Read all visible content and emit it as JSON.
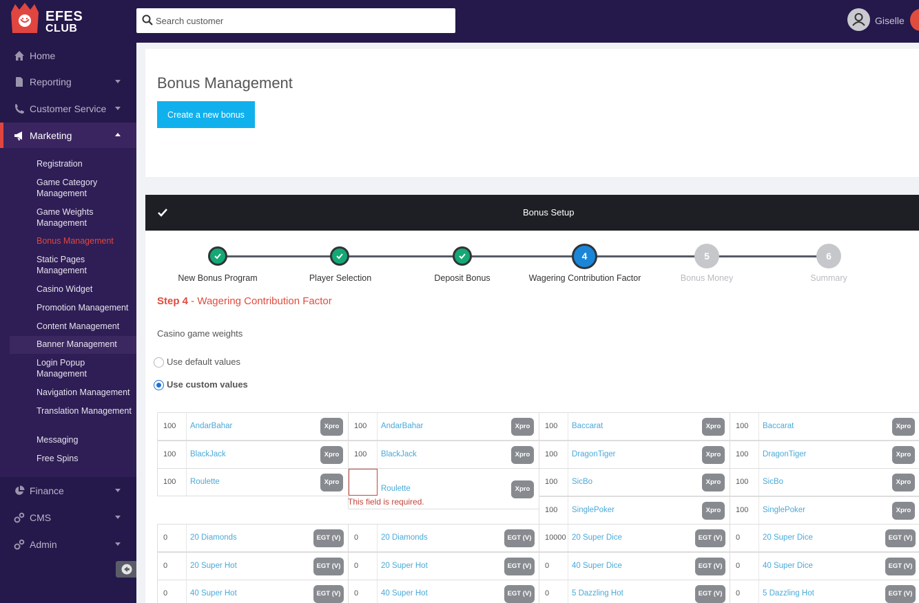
{
  "header": {
    "logo_text_1": "EFES",
    "logo_text_2": "CLUB",
    "search_placeholder": "Search customer",
    "username": "Giselle"
  },
  "sidebar": {
    "items": [
      {
        "label": "Home",
        "icon": "home-icon"
      },
      {
        "label": "Reporting",
        "icon": "file-icon"
      },
      {
        "label": "Customer Service",
        "icon": "phone-icon"
      },
      {
        "label": "Marketing",
        "icon": "megaphone-icon"
      },
      {
        "label": "Finance",
        "icon": "pie-chart-icon"
      },
      {
        "label": "CMS",
        "icon": "cogs-icon"
      },
      {
        "label": "Admin",
        "icon": "cogs-icon"
      }
    ],
    "marketing_sub": [
      "Registration",
      "Game Category Management",
      "Game Weights Management",
      "Bonus Management",
      "Static Pages Management",
      "Casino Widget",
      "Promotion Management",
      "Content Management",
      "Banner Management",
      "Login Popup Management",
      "Navigation Management",
      "Translation Management",
      "Messaging",
      "Free Spins"
    ],
    "active_sub": "Bonus Management"
  },
  "page": {
    "title": "Bonus Management",
    "create_button": "Create a new bonus"
  },
  "wizard": {
    "bar_title": "Bonus Setup",
    "steps": [
      {
        "number": "1",
        "label": "New Bonus Program",
        "state": "done"
      },
      {
        "number": "2",
        "label": "Player Selection",
        "state": "done"
      },
      {
        "number": "3",
        "label": "Deposit Bonus",
        "state": "done"
      },
      {
        "number": "4",
        "label": "Wagering Contribution Factor",
        "state": "current"
      },
      {
        "number": "5",
        "label": "Bonus Money",
        "state": "todo"
      },
      {
        "number": "6",
        "label": "Summary",
        "state": "todo"
      }
    ],
    "heading_step": "Step 4",
    "heading_sep": " - ",
    "heading_text": "Wagering Contribution Factor",
    "section_label": "Casino game weights",
    "radio_default": "Use default values",
    "radio_custom": "Use custom values",
    "error_message": "This field is required."
  },
  "columns": [
    {
      "xpro": [
        {
          "weight": "100",
          "name": "AndarBahar",
          "provider": "Xpro"
        },
        {
          "weight": "100",
          "name": "BlackJack",
          "provider": "Xpro"
        },
        {
          "weight": "100",
          "name": "Roulette",
          "provider": "Xpro"
        }
      ],
      "egt": [
        {
          "weight": "0",
          "name": "20 Diamonds",
          "provider": "EGT (V)"
        },
        {
          "weight": "0",
          "name": "20 Super Hot",
          "provider": "EGT (V)"
        },
        {
          "weight": "0",
          "name": "40 Super Hot",
          "provider": "EGT (V)"
        }
      ]
    },
    {
      "xpro": [
        {
          "weight": "100",
          "name": "AndarBahar",
          "provider": "Xpro"
        },
        {
          "weight": "100",
          "name": "BlackJack",
          "provider": "Xpro"
        },
        {
          "weight": "",
          "name": "Roulette",
          "provider": "Xpro",
          "error": true
        }
      ],
      "egt": [
        {
          "weight": "0",
          "name": "20 Diamonds",
          "provider": "EGT (V)"
        },
        {
          "weight": "0",
          "name": "20 Super Hot",
          "provider": "EGT (V)"
        },
        {
          "weight": "0",
          "name": "40 Super Hot",
          "provider": "EGT (V)"
        }
      ]
    },
    {
      "xpro": [
        {
          "weight": "100",
          "name": "Baccarat",
          "provider": "Xpro"
        },
        {
          "weight": "100",
          "name": "DragonTiger",
          "provider": "Xpro"
        },
        {
          "weight": "100",
          "name": "SicBo",
          "provider": "Xpro"
        },
        {
          "weight": "100",
          "name": "SinglePoker",
          "provider": "Xpro"
        }
      ],
      "egt": [
        {
          "weight": "10000",
          "name": "20 Super Dice",
          "provider": "EGT (V)"
        },
        {
          "weight": "0",
          "name": "40 Super Dice",
          "provider": "EGT (V)"
        },
        {
          "weight": "0",
          "name": "5 Dazzling Hot",
          "provider": "EGT (V)"
        }
      ]
    },
    {
      "xpro": [
        {
          "weight": "100",
          "name": "Baccarat",
          "provider": "Xpro"
        },
        {
          "weight": "100",
          "name": "DragonTiger",
          "provider": "Xpro"
        },
        {
          "weight": "100",
          "name": "SicBo",
          "provider": "Xpro"
        },
        {
          "weight": "100",
          "name": "SinglePoker",
          "provider": "Xpro"
        }
      ],
      "egt": [
        {
          "weight": "0",
          "name": "20 Super Dice",
          "provider": "EGT (V)"
        },
        {
          "weight": "0",
          "name": "40 Super Dice",
          "provider": "EGT (V)"
        },
        {
          "weight": "0",
          "name": "5 Dazzling Hot",
          "provider": "EGT (V)"
        }
      ]
    }
  ],
  "colors": {
    "sidebar_bg": "#25184b",
    "accent_red": "#e0463f",
    "primary_blue": "#10b0ed",
    "step_done": "#14a874",
    "step_current": "#1b86d8",
    "link_blue": "#4aa9d8"
  }
}
